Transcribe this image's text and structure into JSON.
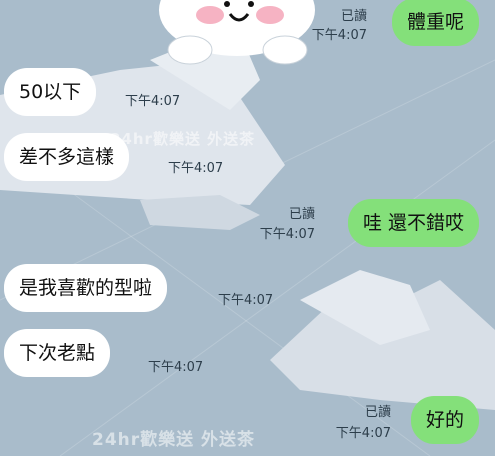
{
  "watermark": "24hr歡樂送 外送茶",
  "messages": [
    {
      "text": "體重呢",
      "side": "out",
      "read": "已讀",
      "time": "下午4:07"
    },
    {
      "text": "50以下",
      "side": "in",
      "time": "下午4:07"
    },
    {
      "text": "差不多這樣",
      "side": "in",
      "time": "下午4:07"
    },
    {
      "text": "哇 還不錯哎",
      "side": "out",
      "read": "已讀",
      "time": "下午4:07"
    },
    {
      "text": "是我喜歡的型啦",
      "side": "in",
      "time": "下午4:07"
    },
    {
      "text": "下次老點",
      "side": "in",
      "time": "下午4:07"
    },
    {
      "text": "好的",
      "side": "out",
      "read": "已讀",
      "time": "下午4:07"
    }
  ],
  "colors": {
    "background": "#a9bccb",
    "incoming_bubble": "#ffffff",
    "outgoing_bubble": "#84e07a"
  }
}
